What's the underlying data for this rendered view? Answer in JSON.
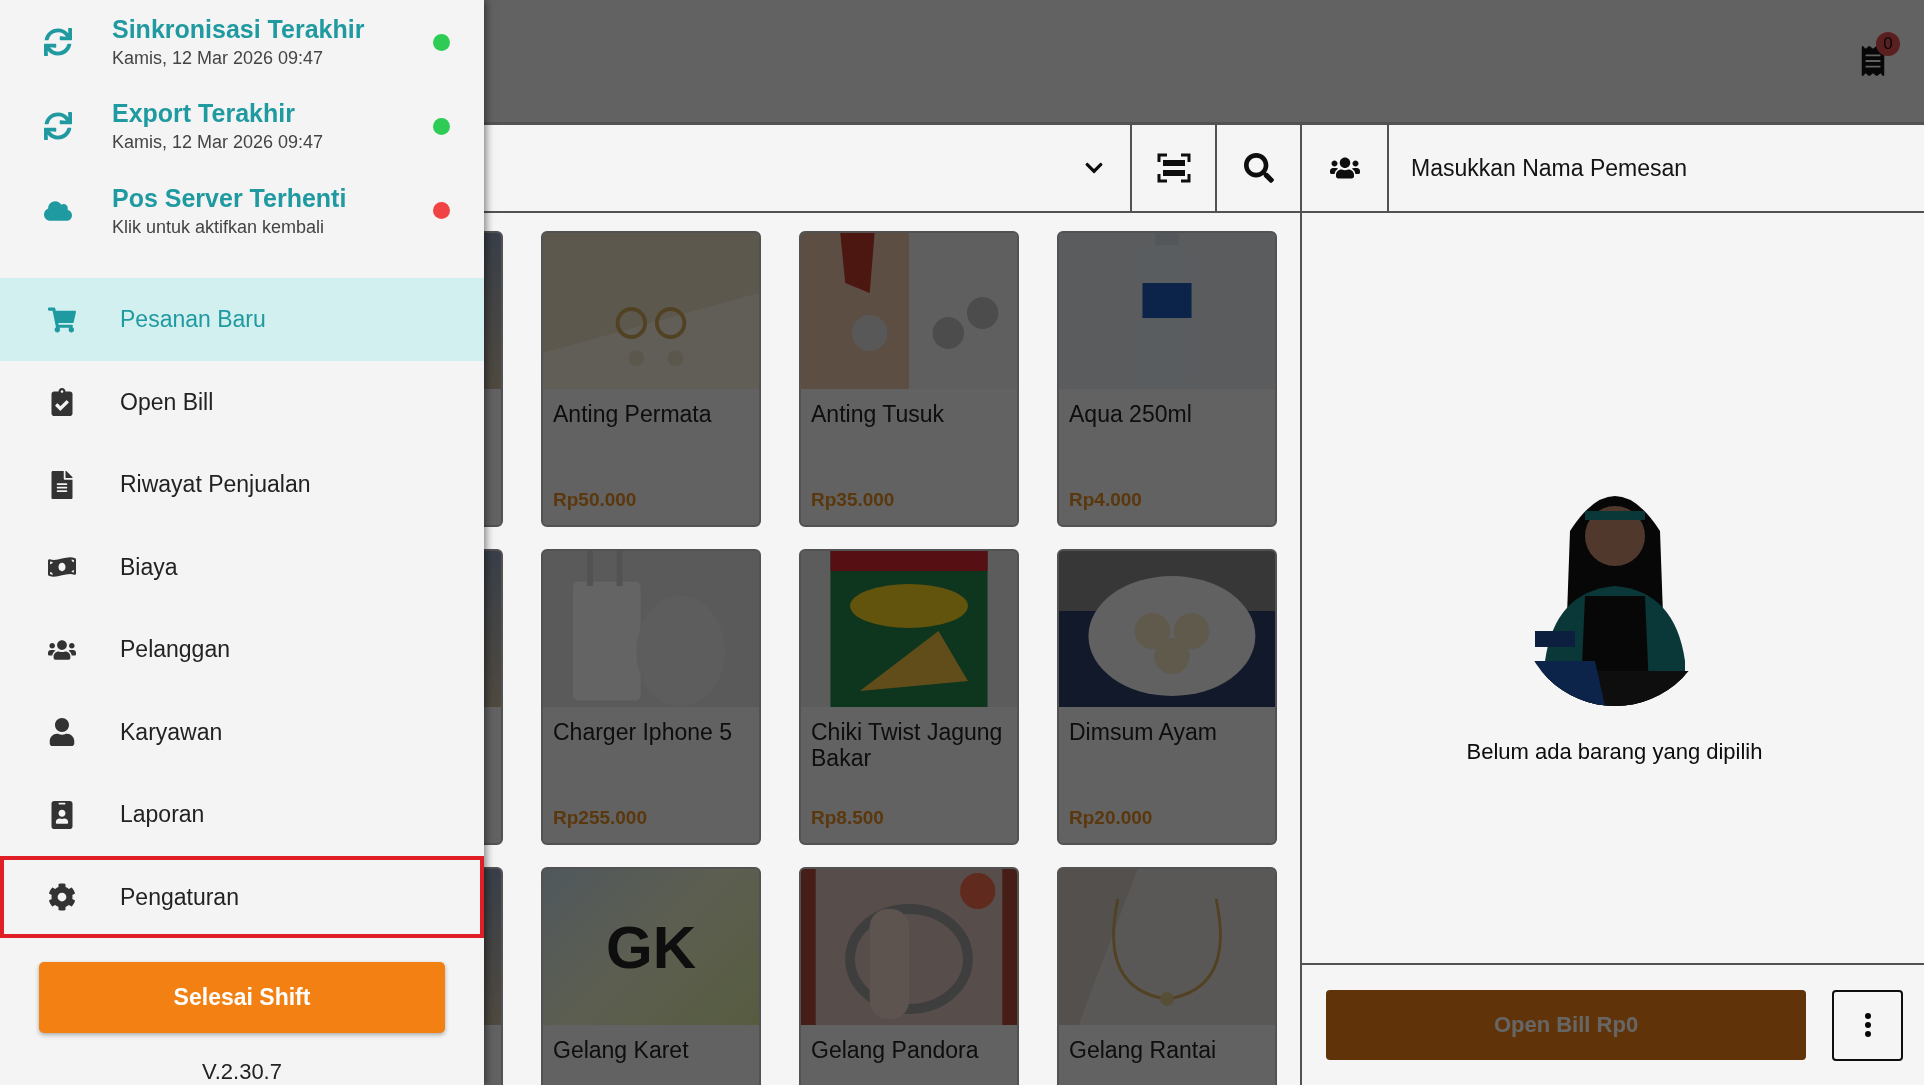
{
  "status_items": [
    {
      "title": "Sinkronisasi Terakhir",
      "subtitle": "Kamis, 12 Mar 2026 09:47",
      "color": "#2ecc55"
    },
    {
      "title": "Export Terakhir",
      "subtitle": "Kamis, 12 Mar 2026 09:47",
      "color": "#2ecc55"
    },
    {
      "title": "Pos Server Terhenti",
      "subtitle": "Klik untuk aktifkan kembali",
      "color": "#f04444"
    }
  ],
  "menu": [
    {
      "label": "Pesanan Baru",
      "selected": true,
      "highlighted": false
    },
    {
      "label": "Open Bill",
      "selected": false,
      "highlighted": false
    },
    {
      "label": "Riwayat Penjualan",
      "selected": false,
      "highlighted": false
    },
    {
      "label": "Biaya",
      "selected": false,
      "highlighted": false
    },
    {
      "label": "Pelanggan",
      "selected": false,
      "highlighted": false
    },
    {
      "label": "Karyawan",
      "selected": false,
      "highlighted": false
    },
    {
      "label": "Laporan",
      "selected": false,
      "highlighted": false
    },
    {
      "label": "Pengaturan",
      "selected": false,
      "highlighted": true
    }
  ],
  "end_shift_button": "Selesai Shift",
  "version": "V.2.30.7",
  "header": {
    "receipt_badge": "0"
  },
  "products": [
    {
      "kind": "partial"
    },
    {
      "name": "Anting Permata",
      "price": "Rp50.000"
    },
    {
      "name": "Anting Tusuk",
      "price": "Rp35.000"
    },
    {
      "name": "Aqua 250ml",
      "price": "Rp4.000"
    },
    {
      "kind": "partial"
    },
    {
      "name": "Charger Iphone 5",
      "price": "Rp255.000"
    },
    {
      "name": "Chiki Twist Jagung Bakar",
      "price": "Rp8.500"
    },
    {
      "name": "Dimsum Ayam",
      "price": "Rp20.000"
    },
    {
      "kind": "partial"
    },
    {
      "kind": "initials",
      "initials": "GK",
      "name": "Gelang Karet"
    },
    {
      "name": "Gelang Pandora"
    },
    {
      "name": "Gelang Rantai"
    }
  ],
  "customer_field": {
    "placeholder": "Masukkan Nama Pemesan"
  },
  "empty_message": "Belum ada barang yang dipilih",
  "open_bill_button": "Open Bill Rp0"
}
